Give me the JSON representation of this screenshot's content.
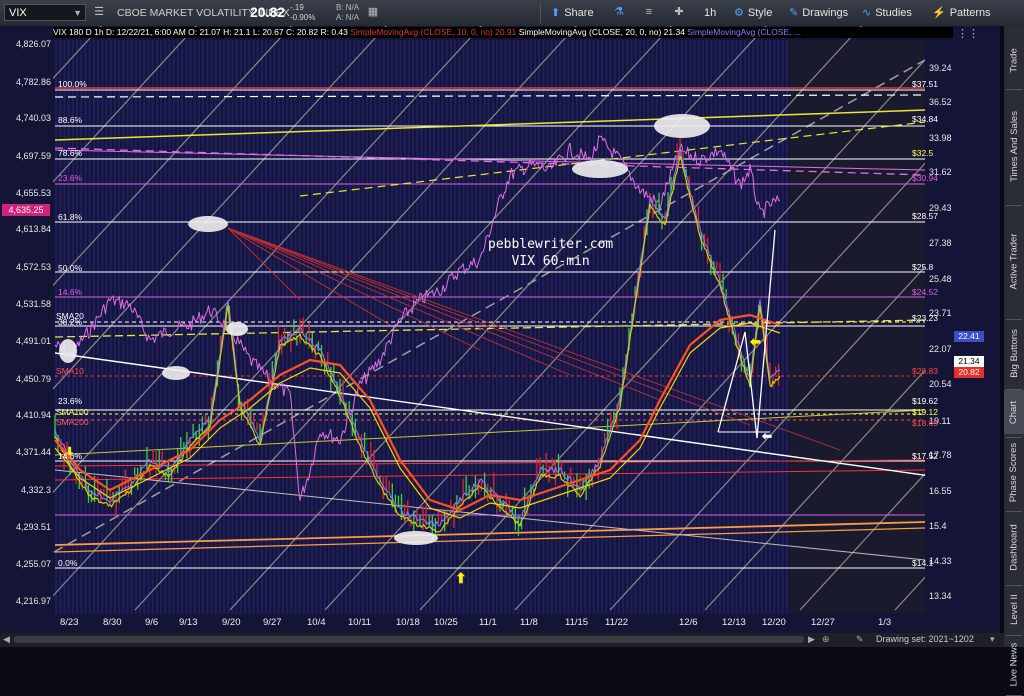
{
  "toolbar": {
    "symbol": "VIX",
    "instrument_name": "CBOE MARKET VOLATILITY INDEX",
    "last": "20.82",
    "change": "-.19",
    "change_pct": "-0.90%",
    "bid": "B: N/A",
    "ask": "A: N/A",
    "share_label": "Share",
    "timeframe_label": "1h",
    "style_label": "Style",
    "drawings_label": "Drawings",
    "studies_label": "Studies",
    "patterns_label": "Patterns"
  },
  "chart_header": {
    "ohlc": "VIX 180 D 1h   D: 12/22/21, 6:00 AM   O: 21.07   H: 21.1   L: 20.67   C: 20.82   R: 0.43",
    "study1": "SimpleMovingAvg (CLOSE, 10, 0, no)  20.91",
    "study2": "SimpleMovingAvg (CLOSE, 20, 0, no)  21.34",
    "study3": "SimpleMovingAvg (CLOSE, ..."
  },
  "left_axis": [
    "4,826.07",
    "4,782.86",
    "4,740.03",
    "4,697.59",
    "4,655.53",
    "4,613.84",
    "4,572.53",
    "4,531.58",
    "4,491.01",
    "4,450.79",
    "4,410.94",
    "4,371.44",
    "4,332.3",
    "4,293.51",
    "4,255.07",
    "4,216.97"
  ],
  "left_price_tag": "4,635.25",
  "right_axis": [
    "39.24",
    "36.52",
    "33.98",
    "31.62",
    "29.43",
    "27.38",
    "25.48",
    "23.71",
    "22.07",
    "20.54",
    "19.11",
    "17.78",
    "16.55",
    "15.4",
    "14.33",
    "13.34"
  ],
  "right_tags": [
    {
      "text": "22.41",
      "color": "#3a4ec8"
    },
    {
      "text": "21.34",
      "color": "#ffffff"
    },
    {
      "text": "20.82",
      "color": "#e8302a"
    }
  ],
  "fib_left": [
    {
      "text": "100.0%",
      "color": "#ffffff"
    },
    {
      "text": "88.6%",
      "color": "#ffffff"
    },
    {
      "text": "78.6%",
      "color": "#ffffff"
    },
    {
      "text": "23.6%",
      "color": "#e060e0"
    },
    {
      "text": "61.8%",
      "color": "#ffffff"
    },
    {
      "text": "50.0%",
      "color": "#ffffff"
    },
    {
      "text": "14.6%",
      "color": "#e060e0"
    },
    {
      "text": "38.2%",
      "color": "#ffffff"
    },
    {
      "text": "23.6%",
      "color": "#ffffff"
    },
    {
      "text": "14.6%",
      "color": "#ffffff"
    },
    {
      "text": "0.0%",
      "color": "#ffffff"
    }
  ],
  "fib_right": [
    {
      "text": "$37.51",
      "color": "#ffffff"
    },
    {
      "text": "$34.84",
      "color": "#ffffff"
    },
    {
      "text": "$32.5",
      "color": "#ffff66"
    },
    {
      "text": "$30.94",
      "color": "#e060e0"
    },
    {
      "text": "$28.57",
      "color": "#ffffff"
    },
    {
      "text": "$25.8",
      "color": "#ffffff"
    },
    {
      "text": "$24.52",
      "color": "#e060e0"
    },
    {
      "text": "$23.23",
      "color": "#ffffff"
    },
    {
      "text": "$20.83",
      "color": "#ff4040"
    },
    {
      "text": "$19.62",
      "color": "#ffffff"
    },
    {
      "text": "$19.12",
      "color": "#ffff66"
    },
    {
      "text": "$18.69",
      "color": "#ff5050"
    },
    {
      "text": "$17.52",
      "color": "#ffffff"
    },
    {
      "text": "$14.1",
      "color": "#ffffff"
    }
  ],
  "sma_labels": [
    {
      "text": "SMA20",
      "color": "#ffffff"
    },
    {
      "text": "SMA10",
      "color": "#ff5050"
    },
    {
      "text": "SMA100",
      "color": "#ffff66"
    },
    {
      "text": "SMA200",
      "color": "#ff6060"
    }
  ],
  "watermark": {
    "line1": "pebblewriter.com",
    "line2": "VIX 60-min"
  },
  "x_axis": [
    "8/23",
    "8/30",
    "9/6",
    "9/13",
    "9/20",
    "9/27",
    "10/4",
    "10/11",
    "10/18",
    "10/25",
    "11/1",
    "11/8",
    "11/15",
    "11/22",
    "12/6",
    "12/13",
    "12/20",
    "12/27",
    "1/3"
  ],
  "sidebar": [
    "Trade",
    "Times And Sales",
    "Active Trader",
    "Big Buttons",
    "Chart",
    "Phase Scores",
    "Dashboard",
    "Level II",
    "Live News"
  ],
  "bottom_bar": {
    "drawing_set": "Drawing set: 2021~1202"
  },
  "colors": {
    "spx": "#e070e0",
    "sma10": "#ff5020",
    "sma20": "#d0d000",
    "sma5": "#8080ff",
    "fib": "#ffffff"
  }
}
